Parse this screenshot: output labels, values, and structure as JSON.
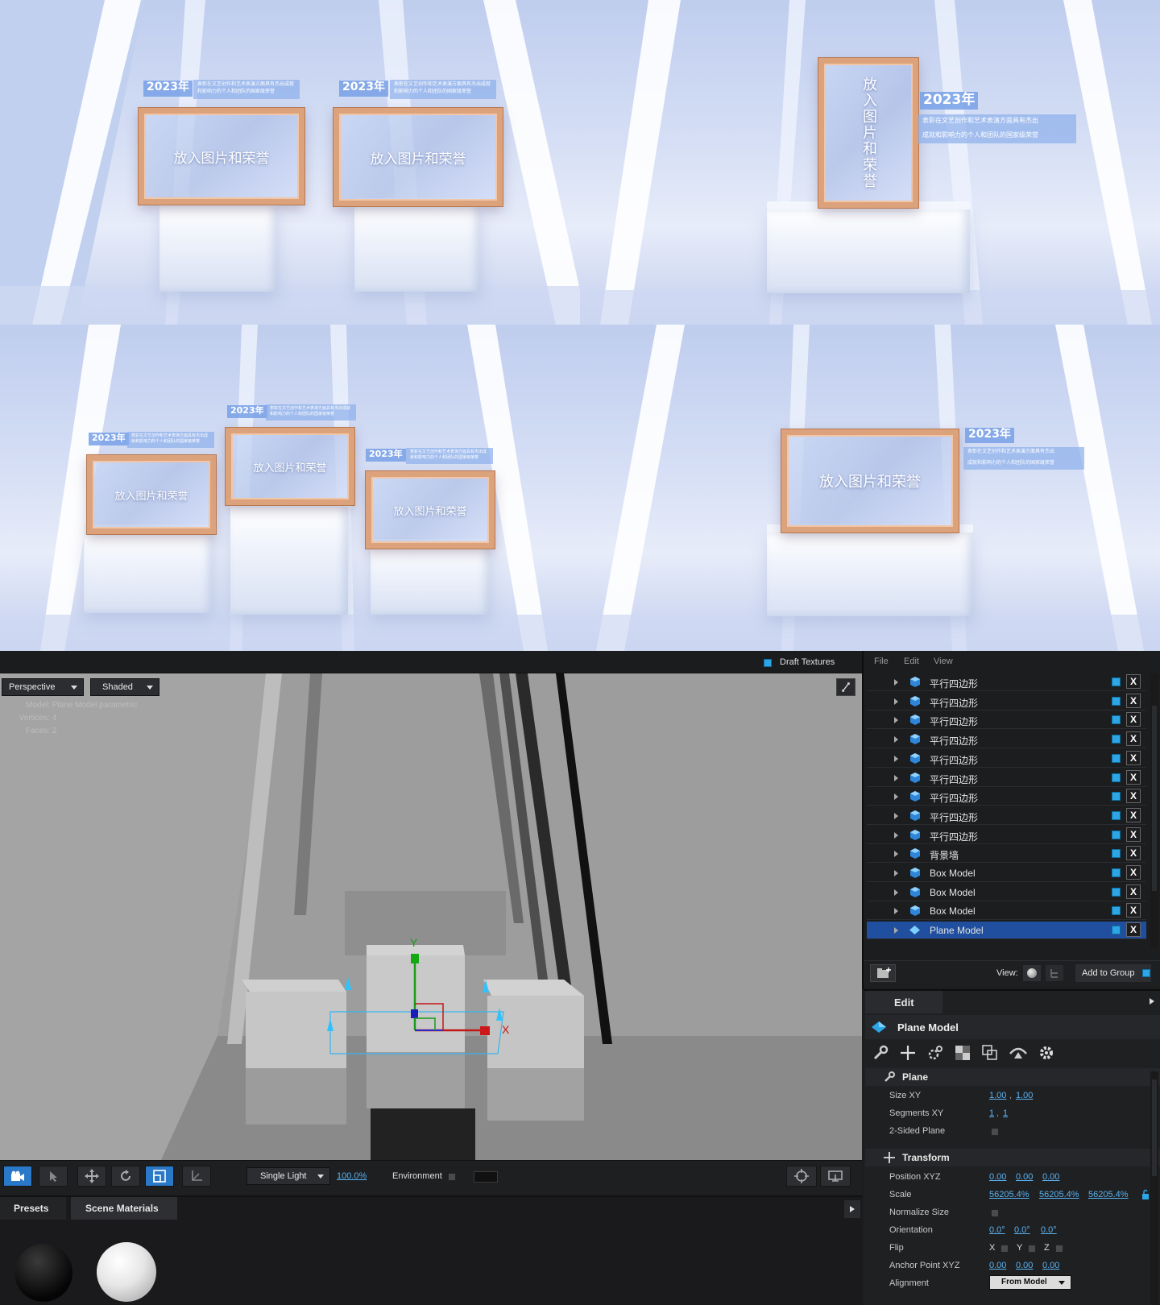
{
  "renders": {
    "panel1": {
      "frames": [
        {
          "year": "2023年",
          "desc": "表彰在文艺创作和艺术表演方面具有杰出成就和影响力的个人和团队的国家级荣誉",
          "placeholder": "放入图片和荣誉"
        },
        {
          "year": "2023年",
          "desc": "表彰在文艺创作和艺术表演方面具有杰出成就和影响力的个人和团队的国家级荣誉",
          "placeholder": "放入图片和荣誉"
        }
      ]
    },
    "panel2": {
      "frame": {
        "year": "2023年",
        "desc_line1": "表彰在文艺创作和艺术表演方面具有杰出",
        "desc_line2": "成就和影响力的个人和团队的国家级荣誉",
        "placeholder": "放入图片和荣誉"
      }
    },
    "panel3": {
      "frames": [
        {
          "year": "2023年",
          "desc": "表彰在文艺创作和艺术表演方面具有杰出成就和影响力的个人和团队的国家级荣誉",
          "placeholder": "放入图片和荣誉"
        },
        {
          "year": "2023年",
          "desc": "表彰在文艺创作和艺术表演方面具有杰出成就和影响力的个人和团队的国家级荣誉",
          "placeholder": "放入图片和荣誉"
        },
        {
          "year": "2023年",
          "desc": "表彰在文艺创作和艺术表演方面具有杰出成就和影响力的个人和团队的国家级荣誉",
          "placeholder": "放入图片和荣誉"
        }
      ]
    },
    "panel4": {
      "frame": {
        "year": "2023年",
        "desc_line1": "表彰在文艺创作和艺术表演方面具有杰出",
        "desc_line2": "成就和影响力的个人和团队的国家级荣誉",
        "placeholder": "放入图片和荣誉"
      }
    }
  },
  "viewport": {
    "draft_textures": "Draft Textures",
    "view_mode": "Perspective",
    "shading_mode": "Shaded",
    "info": {
      "model_label": "Model:",
      "model_value": "Plane Model.parametric",
      "vertices_label": "Vertices:",
      "vertices_value": "4",
      "faces_label": "Faces:",
      "faces_value": "2"
    },
    "gizmo": {
      "y_label": "Y",
      "x_label": "X"
    },
    "toolbar": {
      "light_mode": "Single Light",
      "light_percent": "100.0%",
      "environment_label": "Environment"
    }
  },
  "bottom_tabs": {
    "presets": "Presets",
    "scene_materials": "Scene Materials"
  },
  "scene_panel": {
    "menu": {
      "file": "File",
      "edit": "Edit",
      "view": "View"
    },
    "items": [
      {
        "name": "平行四边形",
        "icon": "extrusion-icon"
      },
      {
        "name": "平行四边形",
        "icon": "extrusion-icon"
      },
      {
        "name": "平行四边形",
        "icon": "extrusion-icon"
      },
      {
        "name": "平行四边形",
        "icon": "extrusion-icon"
      },
      {
        "name": "平行四边形",
        "icon": "extrusion-icon"
      },
      {
        "name": "平行四边形",
        "icon": "extrusion-icon"
      },
      {
        "name": "平行四边形",
        "icon": "extrusion-icon"
      },
      {
        "name": "平行四边形",
        "icon": "extrusion-icon"
      },
      {
        "name": "平行四边形",
        "icon": "extrusion-icon"
      },
      {
        "name": "背景墙",
        "icon": "box-icon"
      },
      {
        "name": "Box Model",
        "icon": "box-icon"
      },
      {
        "name": "Box Model",
        "icon": "box-icon"
      },
      {
        "name": "Box Model",
        "icon": "box-icon"
      },
      {
        "name": "Plane Model",
        "icon": "plane-icon",
        "selected": true
      }
    ],
    "delete_symbol": "X",
    "view_label": "View:",
    "add_to_group": "Add to Group"
  },
  "edit_panel": {
    "tab": "Edit",
    "object_name": "Plane Model",
    "plane_section": "Plane",
    "size_xy": {
      "label": "Size XY",
      "values": [
        "1.00",
        "1.00"
      ]
    },
    "segments_xy": {
      "label": "Segments XY",
      "values": [
        "1",
        "1"
      ]
    },
    "two_sided": {
      "label": "2-Sided Plane"
    },
    "transform_section": "Transform",
    "position": {
      "label": "Position XYZ",
      "values": [
        "0.00",
        "0.00",
        "0.00"
      ]
    },
    "scale": {
      "label": "Scale",
      "values": [
        "56205.4%",
        "56205.4%",
        "56205.4%"
      ]
    },
    "normalize": {
      "label": "Normalize Size"
    },
    "orientation": {
      "label": "Orientation",
      "values": [
        "0.0°",
        "0.0°",
        "0.0°"
      ]
    },
    "flip": {
      "label": "Flip",
      "x": "X",
      "y": "Y",
      "z": "Z"
    },
    "anchor": {
      "label": "Anchor Point XYZ",
      "values": [
        "0.00",
        "0.00",
        "0.00"
      ]
    },
    "alignment": {
      "label": "Alignment",
      "value": "From Model"
    }
  },
  "colors": {
    "accent": "#2ea6e6",
    "selected_row": "#1f4f9e",
    "frame_gold": "#dca27c"
  }
}
